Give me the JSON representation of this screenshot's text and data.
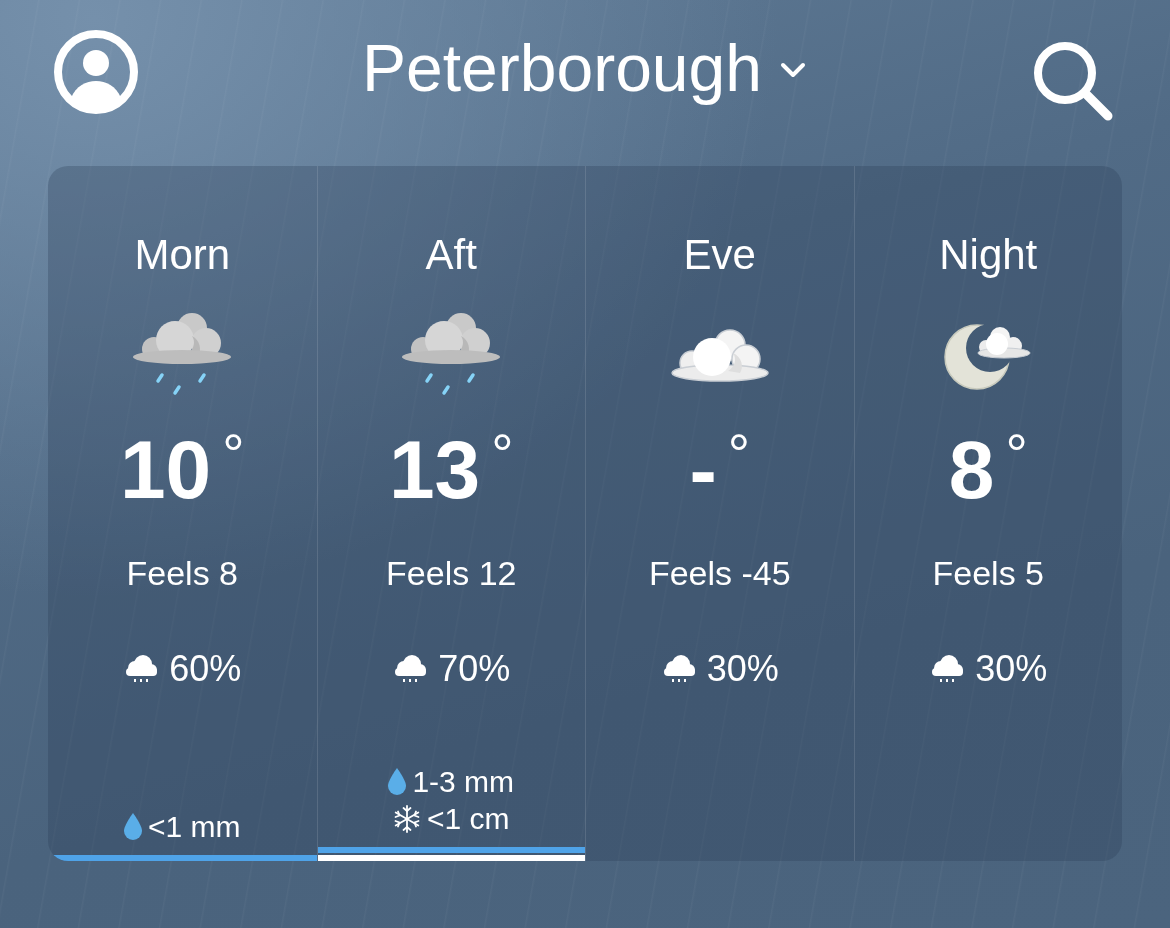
{
  "header": {
    "location": "Peterborough"
  },
  "periods": [
    {
      "label": "Morn",
      "kind": "cloud-rain",
      "temp": "10$^{°}$",
      "feels": "Feels 8",
      "chance": "60%",
      "precipitation": [
        {
          "kind": "rain",
          "amount": "<1 mm"
        }
      ]
    },
    {
      "label": "Aft",
      "kind": "cloud-rain",
      "temp": "13$^{°}$",
      "feels": "Feels 12",
      "chance": "70%",
      "precipitation": [
        {
          "kind": "rain",
          "amount": "1-3 mm"
        },
        {
          "kind": "snow",
          "amount": "<1 cm"
        }
      ]
    },
    {
      "label": "Eve",
      "kind": "cloud",
      "temp": "-$^{°}$",
      "feels": "Feels -45",
      "chance": "30%"
    },
    {
      "label": "Night",
      "kind": "moon-cloud",
      "temp": "8$^{°}$",
      "feels": "Feels 5",
      "chance": "30%"
    }
  ]
}
